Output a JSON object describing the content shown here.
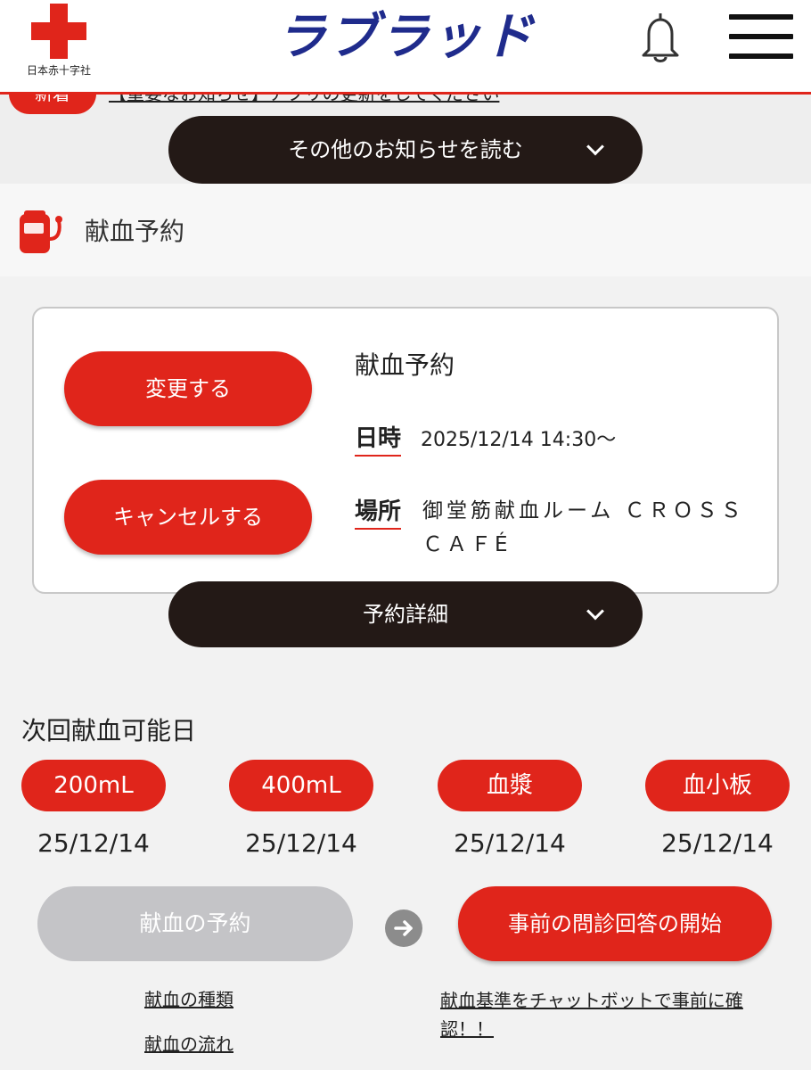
{
  "header": {
    "org_label": "日本赤十字社",
    "brand": "ラブラッド",
    "icons": {
      "bell": "bell-icon",
      "menu": "hamburger-menu-icon"
    },
    "accent_color": "#e0251b",
    "brand_color": "#1f2b8c"
  },
  "notice": {
    "badge": "新着",
    "headline": "【重要なお知らせ】アプリの更新をしてください",
    "more_label": "その他のお知らせを読む"
  },
  "reservation_section": {
    "title": "献血予約",
    "card": {
      "change_label": "変更する",
      "cancel_label": "キャンセルする",
      "title": "献血予約",
      "date_label": "日時",
      "date_value": "2025/12/14 14:30〜",
      "place_label": "場所",
      "place_value": "御堂筋献血ルーム ＣＲＯＳＳ ＣＡＦÉ"
    },
    "detail_label": "予約詳細"
  },
  "next_donation": {
    "title": "次回献血可能日",
    "types": [
      {
        "label": "200mL",
        "date": "25/12/14"
      },
      {
        "label": "400mL",
        "date": "25/12/14"
      },
      {
        "label": "血漿",
        "date": "25/12/14"
      },
      {
        "label": "血小板",
        "date": "25/12/14"
      }
    ]
  },
  "actions": {
    "reserve_label": "献血の予約",
    "precheck_label": "事前の問診回答の開始"
  },
  "links": {
    "types": "献血の種類",
    "flow": "献血の流れ",
    "chatbot": "献血基準をチャットボットで事前に確認！！"
  }
}
